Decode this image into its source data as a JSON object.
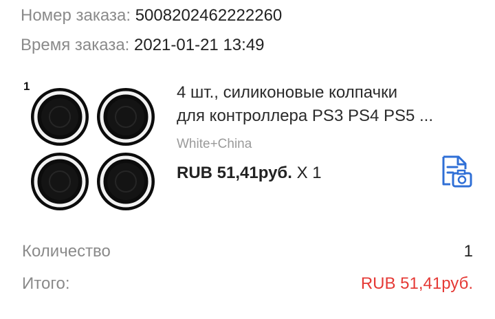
{
  "order": {
    "number_label": "Номер заказа:",
    "number_value": "5008202462222260",
    "time_label": "Время заказа:",
    "time_value": "2021-01-21 13:49"
  },
  "product": {
    "image_badge": "1",
    "title_line1": "4 шт., силиконовые колпачки",
    "title_line2": "для контроллера PS3 PS4 PS5 ...",
    "variant": "White+China",
    "price": "RUB 51,41руб.",
    "quantity_text": "X 1",
    "snapshot_icon": "document-camera-icon"
  },
  "summary": {
    "qty_label": "Количество",
    "qty_value": "1",
    "total_label": "Итого:",
    "total_value": "RUB 51,41руб."
  },
  "colors": {
    "accent": "#2f6fd6",
    "total": "#e53935",
    "label": "#8a8a8a"
  }
}
